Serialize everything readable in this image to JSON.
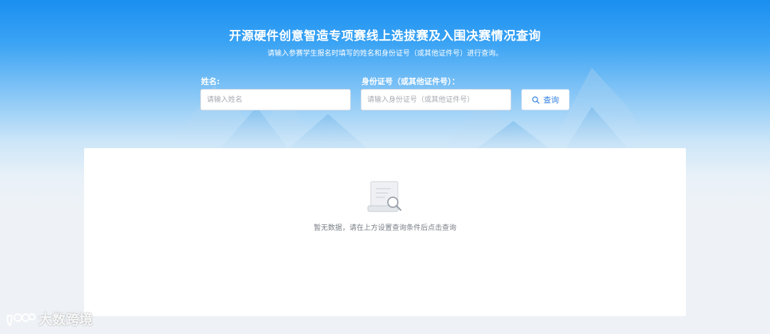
{
  "header": {
    "title": "开源硬件创意智造专项赛线上选拔赛及入围决赛情况查询",
    "subtitle": "请输入参赛学生报名时填写的姓名和身份证号（或其他证件号）进行查询。"
  },
  "form": {
    "name_label": "姓名:",
    "name_placeholder": "请输入姓名",
    "name_value": "",
    "id_label": "身份证号（或其他证件号）：",
    "id_placeholder": "请输入身份证号（或其他证件号）",
    "id_value": "",
    "search_label": "查询",
    "search_icon": "search-icon"
  },
  "results": {
    "empty_icon": "no-data-document-icon",
    "empty_text": "暂无数据，请在上方设置查询条件后点击查询"
  },
  "watermark": {
    "text": "大数跨境",
    "logo": "dashukuajing-logo"
  },
  "colors": {
    "header_blue": "#1a8ff0",
    "accent": "#2f7fe0",
    "background": "#eef1f5"
  }
}
